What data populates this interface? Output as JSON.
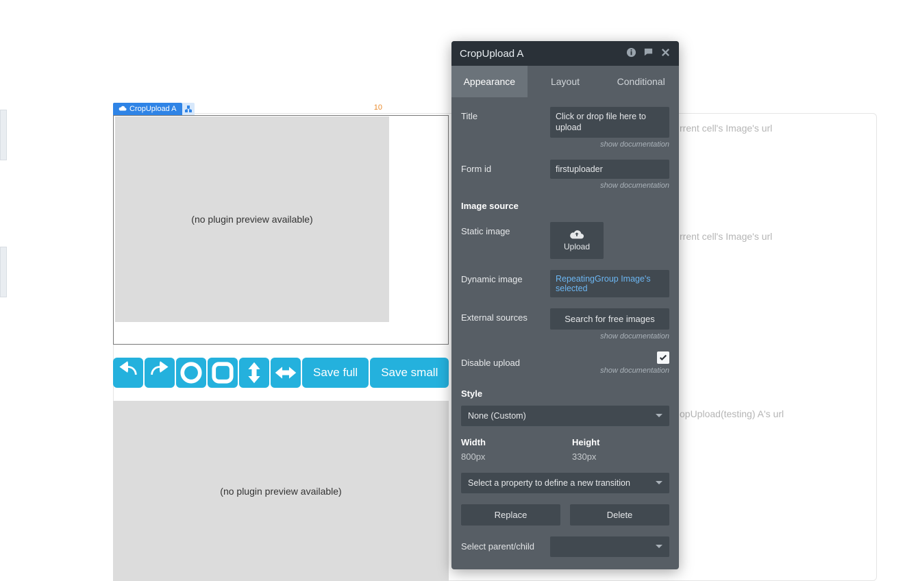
{
  "canvas": {
    "element_tag": "CropUpload A",
    "width_hint": "10",
    "no_preview": "(no plugin preview available)",
    "cell_labels": {
      "l1": "rrent cell's Image's url",
      "l2": "rrent cell's Image's url",
      "l3": "opUpload(testing) A's url"
    },
    "toolbar": {
      "save_full": "Save full",
      "save_small": "Save small"
    }
  },
  "panel": {
    "title": "CropUpload A",
    "tabs": {
      "appearance": "Appearance",
      "layout": "Layout",
      "conditional": "Conditional"
    },
    "doc_link": "show documentation",
    "fields": {
      "title_label": "Title",
      "title_value": "Click or drop file here to upload",
      "form_id_label": "Form id",
      "form_id_value": "firstuploader",
      "image_source_label": "Image source",
      "static_image_label": "Static image",
      "upload_btn": "Upload",
      "dynamic_image_label": "Dynamic image",
      "dynamic_image_value": "RepeatingGroup Image's selected",
      "external_sources_label": "External sources",
      "external_sources_btn": "Search for free images",
      "disable_upload_label": "Disable upload",
      "style_label": "Style",
      "style_value": "None (Custom)",
      "width_label": "Width",
      "width_value": "800px",
      "height_label": "Height",
      "height_value": "330px",
      "transition_placeholder": "Select a property to define a new transition",
      "replace_btn": "Replace",
      "delete_btn": "Delete",
      "select_parent_label": "Select parent/child"
    }
  }
}
